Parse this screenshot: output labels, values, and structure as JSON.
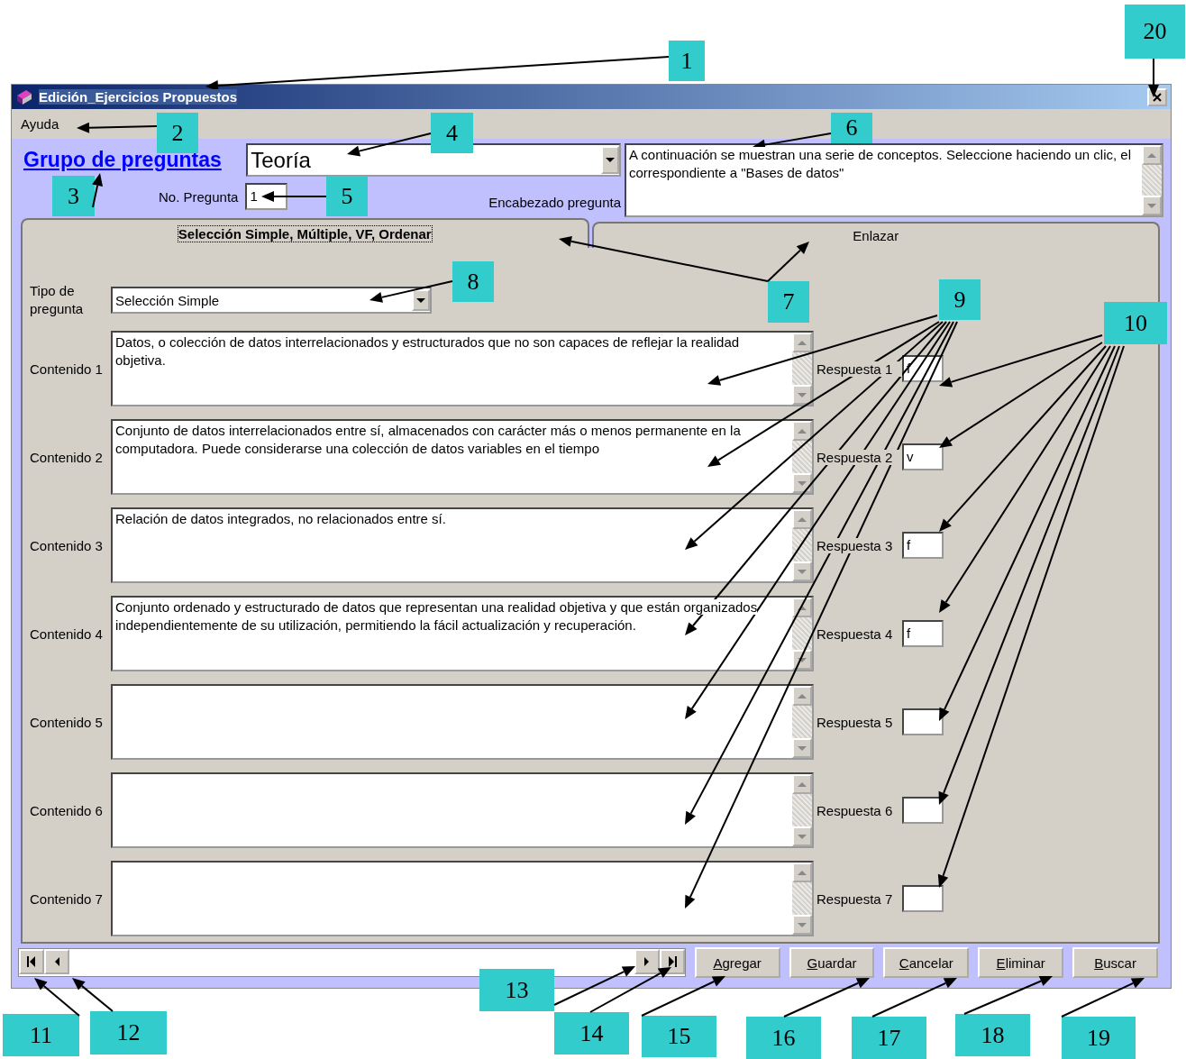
{
  "window": {
    "title": "Edición_Ejercicios Propuestos"
  },
  "menu": [
    "Ayuda"
  ],
  "header": {
    "group_link": "Grupo de preguntas",
    "group_value": "Teoría",
    "number_label": "No. Pregunta",
    "number_value": "1",
    "heading_label": "Encabezado pregunta",
    "heading_text": "A continuación se muestran una serie de conceptos. Seleccione haciendo un clic, el correspondiente a \"Bases de datos\""
  },
  "tabs": [
    {
      "label": "Selección Simple, Múltiple, VF, Ordenar",
      "selected": true
    },
    {
      "label": "Enlazar",
      "selected": false
    }
  ],
  "question_type": {
    "label": "Tipo de pregunta",
    "value": "Selección Simple"
  },
  "rows": [
    {
      "content_label": "Contenido 1",
      "content": "Datos, o colección de datos interrelacionados y estructurados que no son capaces de reflejar la realidad objetiva.",
      "answer_label": "Respuesta 1",
      "answer": "f"
    },
    {
      "content_label": "Contenido 2",
      "content": "Conjunto de datos interrelacionados entre sí, almacenados con carácter más o menos permanente en la computadora.  Puede considerarse una colección de datos variables en el tiempo",
      "answer_label": "Respuesta 2",
      "answer": "v"
    },
    {
      "content_label": "Contenido 3",
      "content": "Relación de datos integrados, no relacionados entre sí.",
      "answer_label": "Respuesta 3",
      "answer": "f"
    },
    {
      "content_label": "Contenido 4",
      "content": "Conjunto ordenado y estructurado de datos que representan una realidad objetiva y que están organizados independientemente de su utilización, permitiendo la fácil actualización y recuperación.",
      "answer_label": "Respuesta 4",
      "answer": "f"
    },
    {
      "content_label": "Contenido 5",
      "answer_label": "Respuesta 5"
    },
    {
      "content_label": "Contenido 6",
      "answer_label": "Respuesta 6"
    },
    {
      "content_label": "Contenido 7",
      "answer_label": "Respuesta 7"
    }
  ],
  "buttons": [
    "Agregar",
    "Guardar",
    "Cancelar",
    "Eliminar",
    "Buscar"
  ],
  "callouts": [
    {
      "number": "1"
    },
    {
      "number": "2"
    },
    {
      "number": "3"
    },
    {
      "number": "4"
    },
    {
      "number": "5"
    },
    {
      "number": "6"
    },
    {
      "number": "7"
    },
    {
      "number": "8"
    },
    {
      "number": "9"
    },
    {
      "number": "10"
    },
    {
      "number": "11"
    },
    {
      "number": "12"
    },
    {
      "number": "13"
    },
    {
      "number": "14"
    },
    {
      "number": "15"
    },
    {
      "number": "16"
    },
    {
      "number": "17"
    },
    {
      "number": "18"
    },
    {
      "number": "19"
    },
    {
      "number": "20"
    }
  ]
}
